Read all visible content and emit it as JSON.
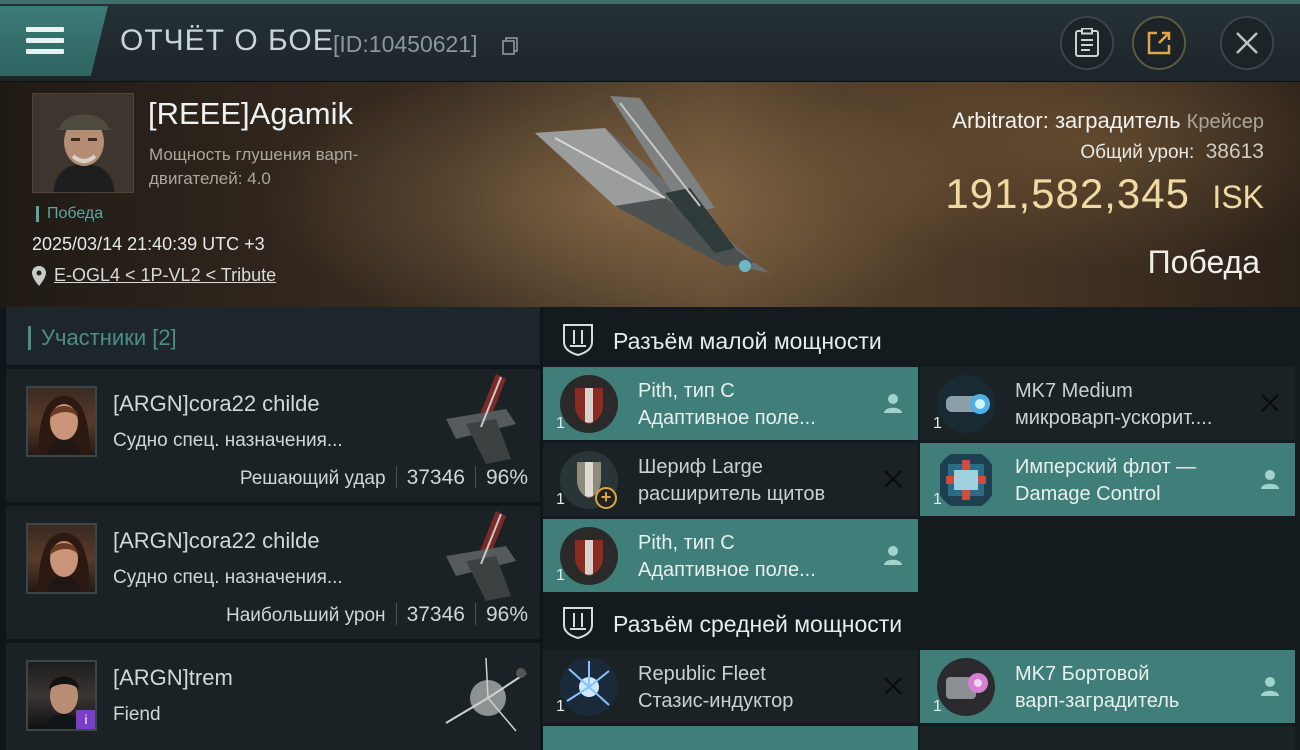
{
  "header": {
    "title": "ОТЧЁТ О БОЕ",
    "report_id": "[ID:10450621]",
    "icons": [
      "menu-icon",
      "copy-icon",
      "report-icon",
      "share-icon",
      "close-icon"
    ]
  },
  "victim": {
    "name": "[REEE]Agamik",
    "warp_label": "Мощность глушения варп-двигателей: 4.0",
    "outcome_tag": "Победа",
    "datetime": "2025/03/14 21:40:39 UTC +3",
    "location": "E-OGL4 < 1P-VL2 < Tribute",
    "ship_name": "Arbitrator: заградитель",
    "ship_class": "Крейсер",
    "total_damage_label": "Общий урон:",
    "total_damage": "38613",
    "isk_value": "191,582,345",
    "isk_unit": "ISK",
    "result": "Победа"
  },
  "participants": {
    "title": "Участники [2]",
    "rows": [
      {
        "name": "[ARGN]cora22 childe",
        "ship": "Судно спец. назначения...",
        "role": "Решающий удар",
        "damage": "37346",
        "percent": "96%"
      },
      {
        "name": "[ARGN]cora22 childe",
        "ship": "Судно спец. назначения...",
        "role": "Наибольший урон",
        "damage": "37346",
        "percent": "96%"
      },
      {
        "name": "[ARGN]trem",
        "ship": "Fiend",
        "badge": "i"
      }
    ]
  },
  "slots": {
    "low": {
      "title": "Разъём малой мощности",
      "modules": [
        {
          "qty": "1",
          "line1": "Pith, тип C",
          "line2": "Адаптивное поле...",
          "state": "fitted"
        },
        {
          "qty": "1",
          "line1": "MK7 Medium",
          "line2": "микроварп-ускорит....",
          "state": "destroyed"
        },
        {
          "qty": "1",
          "line1": "Шериф Large",
          "line2": "расширитель щитов",
          "state": "destroyed"
        },
        {
          "qty": "1",
          "line1": "Имперский флот —",
          "line2": "Damage Control",
          "state": "fitted"
        },
        {
          "qty": "1",
          "line1": "Pith, тип C",
          "line2": "Адаптивное поле...",
          "state": "fitted"
        }
      ]
    },
    "mid": {
      "title": "Разъём средней мощности",
      "modules": [
        {
          "qty": "1",
          "line1": "Republic Fleet",
          "line2": "Стазис-индуктор",
          "state": "destroyed"
        },
        {
          "qty": "1",
          "line1": "MK7 Бортовой",
          "line2": "варп-заградитель",
          "state": "fitted"
        }
      ]
    }
  },
  "colors": {
    "accent_teal": "#407e79",
    "isk_gold": "#f0d9a2",
    "victory_green": "#5ea7a0"
  }
}
